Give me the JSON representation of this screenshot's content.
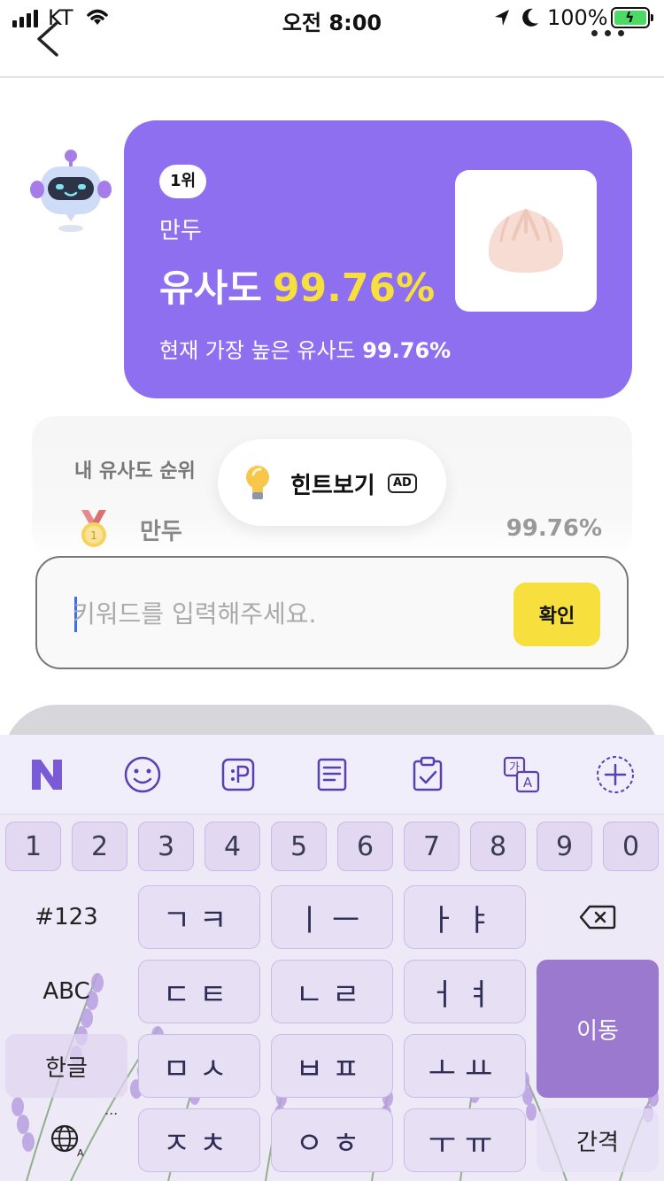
{
  "status": {
    "carrier": "KT",
    "time": "오전 8:00",
    "battery": "100%"
  },
  "card": {
    "rank": "1위",
    "word": "만두",
    "sim_label": "유사도",
    "sim_value": "99.76%",
    "best_prefix": "현재 가장 높은 유사도",
    "best_value": "99.76%"
  },
  "ranking": {
    "title": "내 유사도 순위",
    "word": "만두",
    "pct": "99.76%"
  },
  "hint": {
    "label": "힌트보기",
    "ad": "AD"
  },
  "input": {
    "placeholder": "키워드를 입력해주세요.",
    "value": "",
    "confirm": "확인"
  },
  "keyboard": {
    "numbers": [
      "1",
      "2",
      "3",
      "4",
      "5",
      "6",
      "7",
      "8",
      "9",
      "0"
    ],
    "row1": [
      "ㄱㅋ",
      "ㅣㅡ",
      "ㅏㅑ"
    ],
    "row2": [
      "ㄷㅌ",
      "ㄴㄹ",
      "ㅓㅕ"
    ],
    "row3": [
      "ㅁㅅ",
      "ㅂㅍ",
      "ㅗㅛ"
    ],
    "row4": [
      "ㅈㅊ",
      "ㅇㅎ",
      "ㅜㅠ"
    ],
    "sym_key": "#123",
    "abc_key": "ABC",
    "hangul_key": "한글",
    "move_key": "이동",
    "space_key": "간격",
    "globe_ellipsis": "..."
  },
  "icons": {
    "back": "chevron-left-icon",
    "more": "more-horizontal-icon",
    "tools": [
      "naver-n-icon",
      "emoji-icon",
      "clipboard-p-icon",
      "notes-icon",
      "clipboard-check-icon",
      "translate-icon",
      "add-circle-icon"
    ]
  },
  "colors": {
    "card": "#8e6ff0",
    "highlight": "#f7df3d",
    "confirm": "#f7df3d",
    "keyboard_bg": "#ede9f7",
    "move_key": "#9b79cf"
  }
}
